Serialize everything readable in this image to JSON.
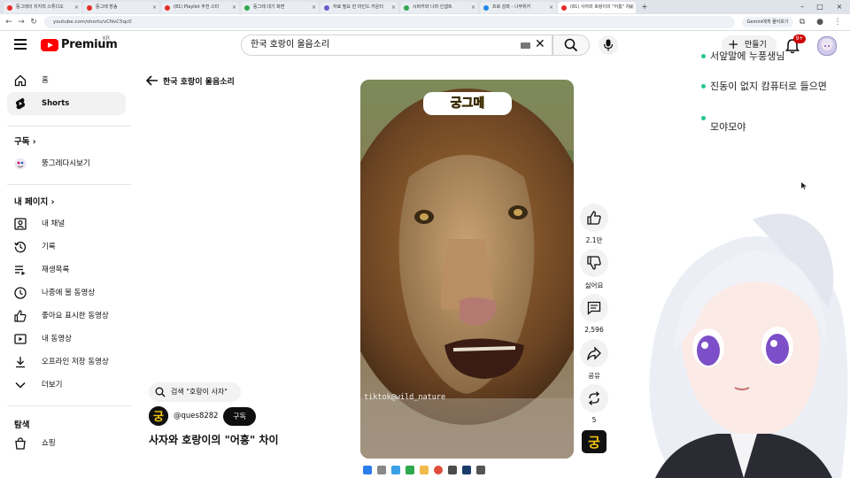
{
  "browser": {
    "tabs": [
      {
        "label": "뚱그레의 치지직 스튜디오"
      },
      {
        "label": "뚱그레 방송"
      },
      {
        "label": "(81) Playlist 추천 스타"
      },
      {
        "label": "뚱그레 대기 화면"
      },
      {
        "label": "자료 필요 한 마인드 카운터"
      },
      {
        "label": "시바카와 나라 인셉트"
      },
      {
        "label": "프로 강좌 - 나무위키"
      },
      {
        "label": "(81) 사자와 호랑이의 \"어흥\" 차이"
      }
    ],
    "url": "youtube.com/shorts/vCNvC5qc0",
    "gemini_label": "Gemini에게 물어보기"
  },
  "header": {
    "logo_text": "Premium",
    "logo_region": "KR",
    "search_value": "한국 호랑이 울음소리",
    "create_label": "만들기",
    "notification_badge": "9+"
  },
  "sidebar": {
    "main": [
      {
        "label": "홈",
        "icon": "home-icon"
      },
      {
        "label": "Shorts",
        "icon": "shorts-icon",
        "active": true
      }
    ],
    "subscriptions_title": "구독",
    "subscriptions": [
      {
        "label": "뚱그레다시보기"
      }
    ],
    "you_title": "내 페이지",
    "you": [
      {
        "label": "내 채널",
        "icon": "channel-icon"
      },
      {
        "label": "기록",
        "icon": "history-icon"
      },
      {
        "label": "재생목록",
        "icon": "playlist-icon"
      },
      {
        "label": "나중에 볼 동영상",
        "icon": "watch-later-icon"
      },
      {
        "label": "좋아요 표시한 동영상",
        "icon": "thumbs-up-icon"
      },
      {
        "label": "내 동영상",
        "icon": "video-icon"
      },
      {
        "label": "오프라인 저장 동영상",
        "icon": "download-icon"
      },
      {
        "label": "더보기",
        "icon": "chevron-down-icon"
      }
    ],
    "explore_title": "탐색",
    "explore": [
      {
        "label": "쇼핑",
        "icon": "shopping-icon"
      }
    ]
  },
  "shorts": {
    "page_title": "한국 호랑이 울음소리",
    "video_caption": "궁그메",
    "watermark": "tiktok@wild_nature",
    "search_chip": "검색 \"호랑이 사자\"",
    "channel_name": "@ques8282",
    "subscribe_label": "구독",
    "video_title": "사자와 호랑이의 \"어흥\" 차이",
    "channel_avatar_text": "궁"
  },
  "actions": {
    "like_count": "2.1만",
    "dislike_label": "싫어요",
    "comment_count": "2,596",
    "share_label": "공유",
    "remix_count": "5"
  },
  "chat": [
    {
      "text": "서앞말에 누풍생님"
    },
    {
      "text": "진동이 없지 캄퓨터로 들으면"
    },
    {
      "text": "모야모야"
    }
  ],
  "colors": {
    "brand_red": "#ff0000",
    "chat_dot": "#27c48f",
    "caption_yellow": "#f1c40f"
  }
}
